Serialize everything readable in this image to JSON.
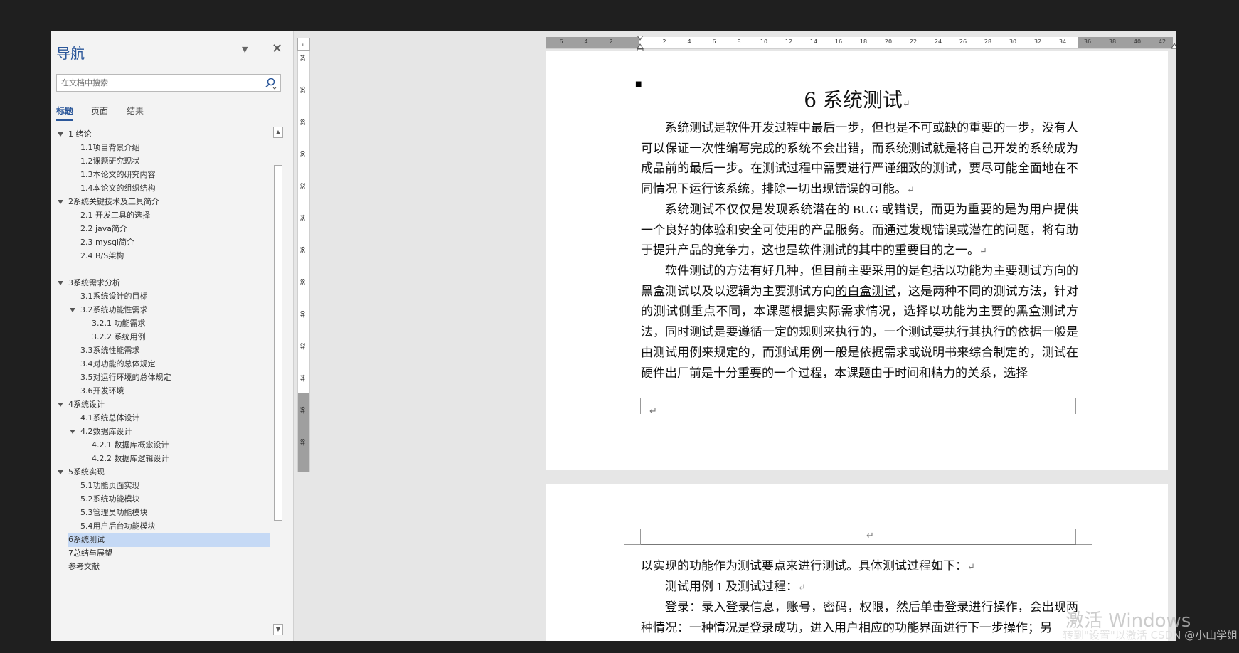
{
  "nav": {
    "title": "导航",
    "search_placeholder": "在文档中搜索",
    "tabs": [
      "标题",
      "页面",
      "结果"
    ],
    "tree": [
      {
        "label": "1 绪论",
        "level": 1,
        "expanded": true
      },
      {
        "label": "1.1项目背景介绍",
        "level": 2
      },
      {
        "label": "1.2课题研究现状",
        "level": 2
      },
      {
        "label": "1.3本论文的研究内容",
        "level": 2
      },
      {
        "label": "1.4本论文的组织结构",
        "level": 2
      },
      {
        "label": "2系统关键技术及工具简介",
        "level": 1,
        "expanded": true
      },
      {
        "label": "2.1 开发工具的选择",
        "level": 2
      },
      {
        "label": "2.2 java简介",
        "level": 2
      },
      {
        "label": "2.3 mysql简介",
        "level": 2
      },
      {
        "label": "2.4 B/S架构",
        "level": 2
      },
      {
        "label": "3系统需求分析",
        "level": 1,
        "expanded": true
      },
      {
        "label": "3.1系统设计的目标",
        "level": 2
      },
      {
        "label": "3.2系统功能性需求",
        "level": 2,
        "expanded": true
      },
      {
        "label": "3.2.1 功能需求",
        "level": 3
      },
      {
        "label": "3.2.2 系统用例",
        "level": 3
      },
      {
        "label": "3.3系统性能需求",
        "level": 2
      },
      {
        "label": "3.4对功能的总体规定",
        "level": 2
      },
      {
        "label": "3.5对运行环境的总体规定",
        "level": 2
      },
      {
        "label": "3.6开发环境",
        "level": 2
      },
      {
        "label": "4系统设计",
        "level": 1,
        "expanded": true
      },
      {
        "label": "4.1系统总体设计",
        "level": 2
      },
      {
        "label": "4.2数据库设计",
        "level": 2,
        "expanded": true
      },
      {
        "label": "4.2.1 数据库概念设计",
        "level": 3
      },
      {
        "label": "4.2.2 数据库逻辑设计",
        "level": 3
      },
      {
        "label": "5系统实现",
        "level": 1,
        "expanded": true
      },
      {
        "label": "5.1功能页面实现",
        "level": 2
      },
      {
        "label": "5.2系统功能模块",
        "level": 2
      },
      {
        "label": "5.3管理员功能模块",
        "level": 2
      },
      {
        "label": "5.4用户后台功能模块",
        "level": 2
      },
      {
        "label": "6系统测试",
        "level": 1,
        "selected": true
      },
      {
        "label": "7总结与展望",
        "level": 1
      },
      {
        "label": "参考文献",
        "level": 1
      }
    ]
  },
  "ruler": {
    "horizontal_ticks": [
      "6",
      "4",
      "2",
      "2",
      "4",
      "6",
      "8",
      "10",
      "12",
      "14",
      "16",
      "18",
      "20",
      "22",
      "24",
      "26",
      "28",
      "30",
      "32",
      "34",
      "36",
      "38",
      "40",
      "42"
    ],
    "vertical_ticks": [
      "24",
      "26",
      "28",
      "30",
      "32",
      "34",
      "36",
      "38",
      "40",
      "42",
      "44",
      "46",
      "48"
    ]
  },
  "document": {
    "page1": {
      "heading": "6 系统测试",
      "para1": "系统测试是软件开发过程中最后一步，但也是不可或缺的重要的一步，没有人可以保证一次性编写完成的系统不会出错，而系统测试就是将自己开发的系统成为成品前的最后一步。在测试过程中需要进行严谨细致的测试，要尽可能全面地在不同情况下运行该系统，排除一切出现错误的可能。",
      "para2": "系统测试不仅仅是发现系统潜在的 BUG 或错误，而更为重要的是为用户提供一个良好的体验和安全可使用的产品服务。而通过发现错误或潜在的问题，将有助于提升产品的竞争力，这也是软件测试的其中的重要目的之一。",
      "para3_a": "软件测试的方法有好几种，但目前主要采用的是包括以功能为主要测试方向的黑盒测试以及以逻辑为主要测试方向",
      "para3_link": "的白盒测试",
      "para3_b": "，这是两种不同的测试方法，针对的测试侧重点不同，本课题根据实际需求情况，选择以功能为主要的黑盒测试方法，同时测试是要遵循一定的规则来执行的，一个测试要执行其执行的依据一般是由测试用例来规定的，而测试用例一般是依据需求或说明书来综合制定的，测试在硬件出厂前是十分重要的一个过程，本课题由于时间和精力的关系，选择"
    },
    "page2": {
      "para1": "以实现的功能作为测试要点来进行测试。具体测试过程如下：",
      "para2": "测试用例 1 及测试过程：",
      "para3": "登录：录入登录信息，账号，密码，权限，然后单击登录进行操作，会出现两种情况：一种情况是登录成功，进入用户相应的功能界面进行下一步操作；另"
    },
    "para_mark": "↵"
  },
  "overlay": {
    "activate_windows": "激活 Windows",
    "watermark": "转到\"设置\"以激活 CSDN @小山学姐"
  },
  "colors": {
    "accent": "#2b579a",
    "selected_item": "#c5d9f5"
  }
}
